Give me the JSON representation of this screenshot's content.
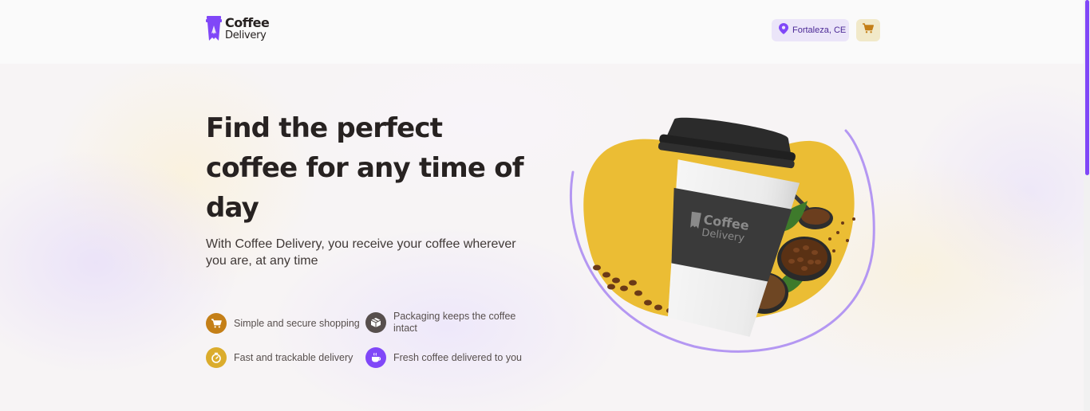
{
  "header": {
    "logo": {
      "line1": "Coffee",
      "line2": "Delivery"
    },
    "location": {
      "icon": "map-pin-icon",
      "label": "Fortaleza, CE"
    },
    "cart": {
      "icon": "shopping-cart-icon"
    }
  },
  "hero": {
    "title": "Find the perfect coffee for any time of day",
    "subtitle": "With Coffee Delivery, you receive your coffee wherever you are, at any time",
    "features": [
      {
        "icon": "shopping-cart-icon",
        "label": "Simple and secure shopping",
        "color": "#C47F17"
      },
      {
        "icon": "package-icon",
        "label": "Packaging keeps the coffee intact",
        "color": "#574F4D"
      },
      {
        "icon": "timer-icon",
        "label": "Fast and trackable delivery",
        "color": "#DBAC2C"
      },
      {
        "icon": "coffee-icon",
        "label": "Fresh coffee delivered to you",
        "color": "#8047F8"
      }
    ],
    "image": {
      "cup_logo_line1": "Coffee",
      "cup_logo_line2": "Delivery"
    }
  },
  "colors": {
    "purple": "#8047F8",
    "purple_light": "#EBE5F9",
    "purple_dark": "#4B2995",
    "yellow": "#DBAC2C",
    "yellow_light": "#F1E9C9",
    "yellow_dark": "#C47F17",
    "background": "#FAFAFA"
  }
}
